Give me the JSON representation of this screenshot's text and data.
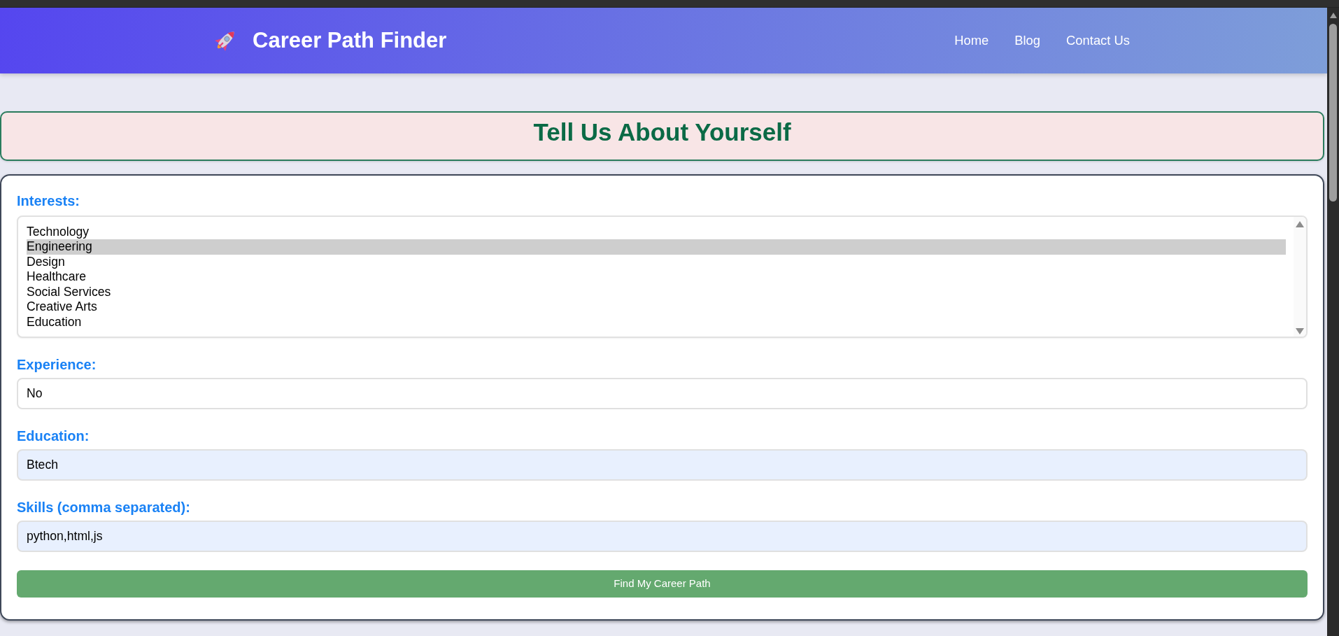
{
  "header": {
    "brand": "Career Path Finder",
    "nav": [
      {
        "label": "Home"
      },
      {
        "label": "Blog"
      },
      {
        "label": "Contact Us"
      }
    ]
  },
  "page_title": "Tell Us About Yourself",
  "form": {
    "fields": [
      {
        "kind": "listbox",
        "label": "Interests:",
        "options": [
          {
            "label": "Technology",
            "selected": false
          },
          {
            "label": "Engineering",
            "selected": true
          },
          {
            "label": "Design",
            "selected": false
          },
          {
            "label": "Healthcare",
            "selected": false
          },
          {
            "label": "Social Services",
            "selected": false
          },
          {
            "label": "Creative Arts",
            "selected": false
          },
          {
            "label": "Education",
            "selected": false
          }
        ]
      },
      {
        "kind": "text",
        "label": "Experience:",
        "value": "No",
        "autofilled": false
      },
      {
        "kind": "text",
        "label": "Education:",
        "value": "Btech",
        "autofilled": true
      },
      {
        "kind": "text",
        "label": "Skills (comma separated):",
        "value": "python,html,js",
        "autofilled": true
      }
    ],
    "submit": "Find My Career Path"
  }
}
